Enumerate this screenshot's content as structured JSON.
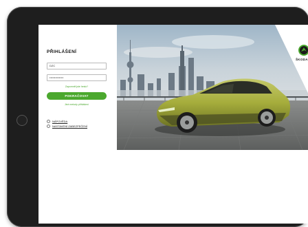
{
  "login": {
    "title": "PŘIHLÁŠENÍ",
    "username_value": "DZC",
    "password_value": "••••••••••••",
    "forgot_link": "Zapomněl jste heslo?",
    "continue_button": "POKRAČOVAT",
    "other_login_link": "Jiné metody přihlášení"
  },
  "help_links": [
    {
      "label": "NÁPOVĚDA",
      "icon": "help-circle-icon"
    },
    {
      "label": "NASTAVENÍ ZABEZPEČENÍ",
      "icon": "settings-circle-icon"
    }
  ],
  "brand": {
    "name": "ŠKODA",
    "accent_color": "#4ba82e"
  }
}
